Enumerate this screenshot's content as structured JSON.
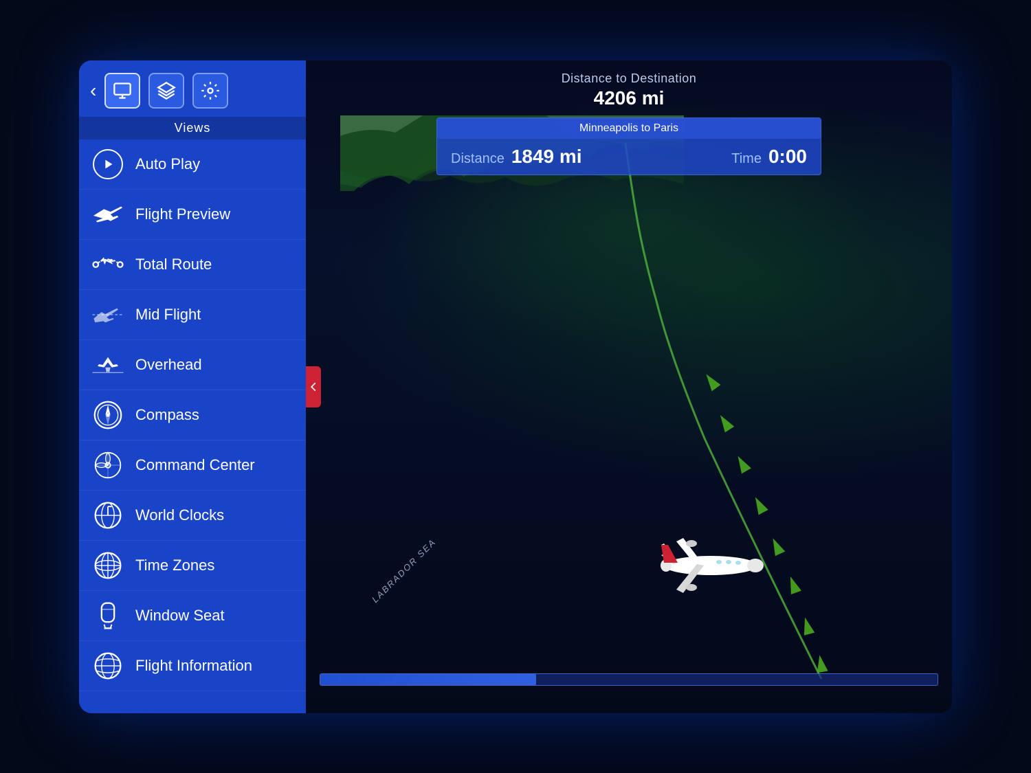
{
  "sidebar": {
    "views_label": "Views",
    "back_label": "‹",
    "menu_items": [
      {
        "id": "auto-play",
        "label": "Auto Play",
        "icon": "play"
      },
      {
        "id": "flight-preview",
        "label": "Flight Preview",
        "icon": "plane-tilt"
      },
      {
        "id": "total-route",
        "label": "Total Route",
        "icon": "plane-route"
      },
      {
        "id": "mid-flight",
        "label": "Mid Flight",
        "icon": "plane-cross"
      },
      {
        "id": "overhead",
        "label": "Overhead",
        "icon": "plane-overhead"
      },
      {
        "id": "compass",
        "label": "Compass",
        "icon": "compass"
      },
      {
        "id": "command-center",
        "label": "Command Center",
        "icon": "command"
      },
      {
        "id": "world-clocks",
        "label": "World Clocks",
        "icon": "globe-clock"
      },
      {
        "id": "time-zones",
        "label": "Time Zones",
        "icon": "globe"
      },
      {
        "id": "window-seat",
        "label": "Window Seat",
        "icon": "headset"
      },
      {
        "id": "flight-information",
        "label": "Flight Information",
        "icon": "globe-info"
      }
    ]
  },
  "main": {
    "distance_to_dest_label": "Distance to Destination",
    "distance_to_dest_value": "4206 mi",
    "route_label": "Minneapolis to Paris",
    "distance_label": "Distance",
    "distance_value": "1849 mi",
    "time_label": "Time",
    "time_value": "0:00",
    "map_region_label": "LABRADOR SEA",
    "progress_percent": 35
  }
}
